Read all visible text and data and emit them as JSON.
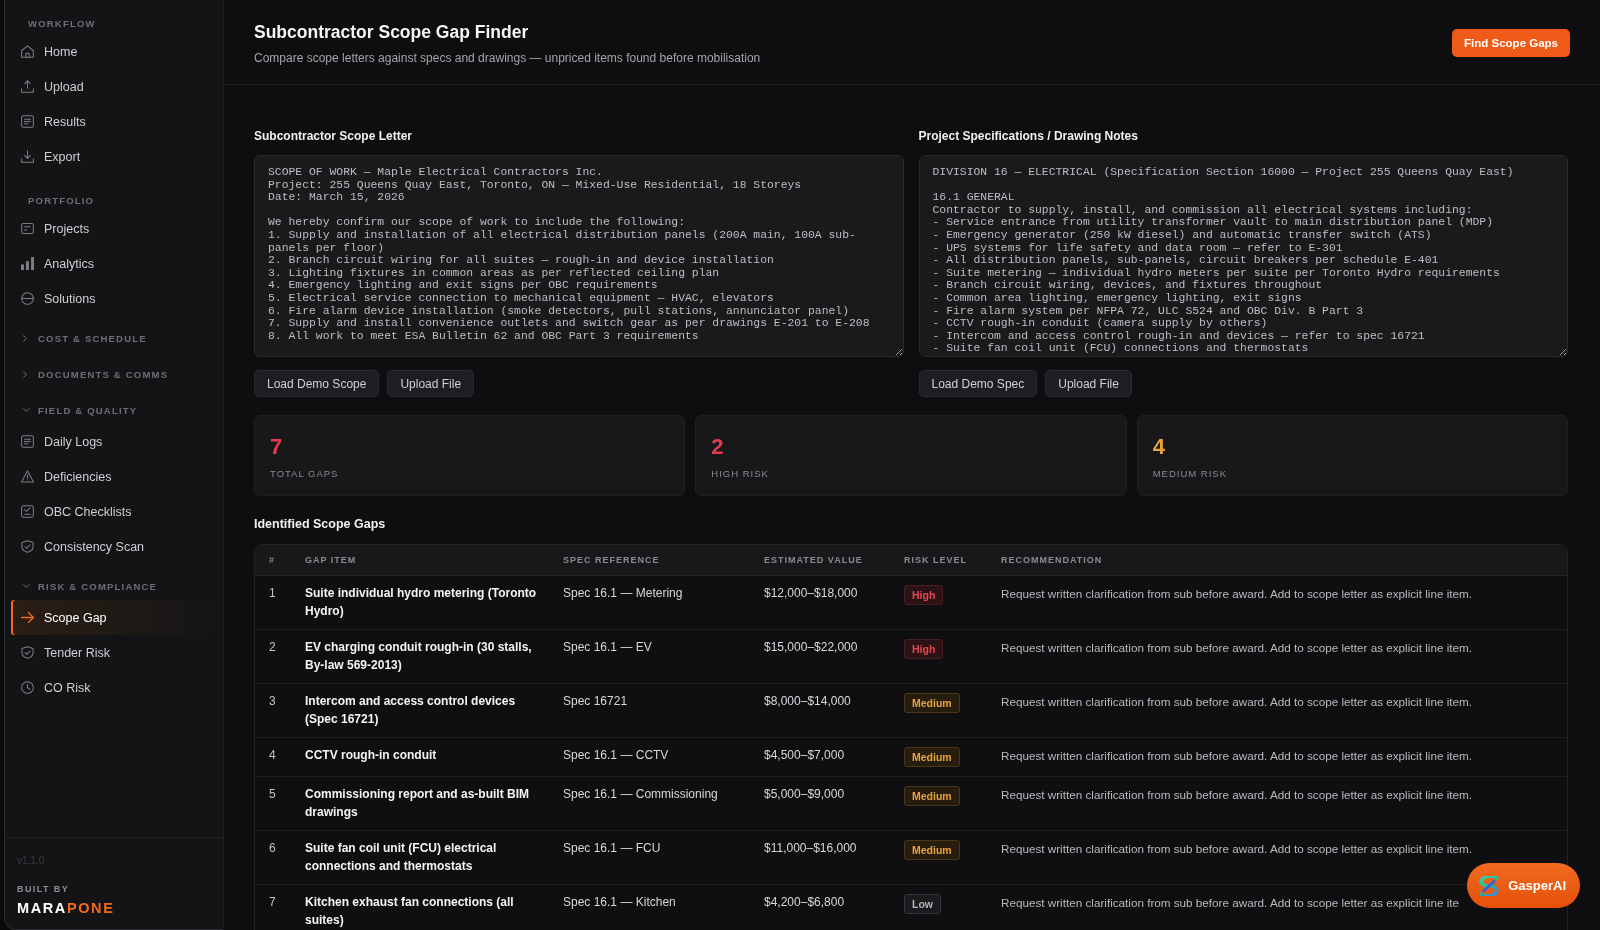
{
  "sidebar": {
    "sections": [
      {
        "kind": "label",
        "title": "WORKFLOW",
        "items": [
          {
            "label": "Home",
            "selected": false
          },
          {
            "label": "Upload",
            "selected": false
          },
          {
            "label": "Results",
            "selected": false
          },
          {
            "label": "Export",
            "selected": false
          }
        ]
      },
      {
        "kind": "label",
        "title": "PORTFOLIO",
        "items": [
          {
            "label": "Projects",
            "selected": false
          },
          {
            "label": "Analytics",
            "selected": false
          },
          {
            "label": "Solutions",
            "selected": false
          }
        ]
      },
      {
        "kind": "group",
        "title": "COST & SCHEDULE",
        "expanded": false
      },
      {
        "kind": "group",
        "title": "DOCUMENTS & COMMS",
        "expanded": false
      },
      {
        "kind": "group",
        "title": "FIELD & QUALITY",
        "expanded": true,
        "items": [
          {
            "label": "Daily Logs",
            "selected": false
          },
          {
            "label": "Deficiencies",
            "selected": false
          },
          {
            "label": "OBC Checklists",
            "selected": false
          },
          {
            "label": "Consistency Scan",
            "selected": false
          }
        ]
      },
      {
        "kind": "group",
        "title": "RISK & COMPLIANCE",
        "expanded": true,
        "items": [
          {
            "label": "Scope Gap",
            "selected": true
          },
          {
            "label": "Tender Risk",
            "selected": false
          },
          {
            "label": "CO Risk",
            "selected": false
          }
        ]
      }
    ],
    "version": "v1.1.0",
    "built_by": "BUILT BY",
    "brand": {
      "text": "MARA",
      "accent": "PONE"
    }
  },
  "header": {
    "title": "Subcontractor Scope Gap Finder",
    "subtitle": "Compare scope letters against specs and drawings — unpriced items found before mobilisation",
    "action_button": "Find Scope Gaps"
  },
  "inputs": [
    {
      "label": "Subcontractor Scope Letter",
      "value": "SCOPE OF WORK — Maple Electrical Contractors Inc.\nProject: 255 Queens Quay East, Toronto, ON — Mixed-Use Residential, 18 Storeys\nDate: March 15, 2026\n\nWe hereby confirm our scope of work to include the following:\n1. Supply and installation of all electrical distribution panels (200A main, 100A sub-panels per floor)\n2. Branch circuit wiring for all suites — rough-in and device installation\n3. Lighting fixtures in common areas as per reflected ceiling plan\n4. Emergency lighting and exit signs per OBC requirements\n5. Electrical service connection to mechanical equipment — HVAC, elevators\n6. Fire alarm device installation (smoke detectors, pull stations, annunciator panel)\n7. Supply and install convenience outlets and switch gear as per drawings E-201 to E-208\n8. All work to meet ESA Bulletin 62 and OBC Part 3 requirements",
      "buttons": [
        "Load Demo Scope",
        "Upload File"
      ]
    },
    {
      "label": "Project Specifications / Drawing Notes",
      "value": "DIVISION 16 — ELECTRICAL (Specification Section 16000 — Project 255 Queens Quay East)\n\n16.1 GENERAL\nContractor to supply, install, and commission all electrical systems including:\n- Service entrance from utility transformer vault to main distribution panel (MDP)\n- Emergency generator (250 kW diesel) and automatic transfer switch (ATS)\n- UPS systems for life safety and data room — refer to E-301\n- All distribution panels, sub-panels, circuit breakers per schedule E-401\n- Suite metering — individual hydro meters per suite per Toronto Hydro requirements\n- Branch circuit wiring, devices, and fixtures throughout\n- Common area lighting, emergency lighting, exit signs\n- Fire alarm system per NFPA 72, ULC S524 and OBC Div. B Part 3\n- CCTV rough-in conduit (camera supply by others)\n- Intercom and access control rough-in and devices — refer to spec 16721\n- Suite fan coil unit (FCU) connections and thermostats",
      "buttons": [
        "Load Demo Spec",
        "Upload File"
      ]
    }
  ],
  "stats": [
    {
      "value": "7",
      "label": "TOTAL GAPS",
      "color": "#e5394f"
    },
    {
      "value": "2",
      "label": "HIGH RISK",
      "color": "#e5394f"
    },
    {
      "value": "4",
      "label": "MEDIUM RISK",
      "color": "#e8a33d"
    }
  ],
  "gaps_table": {
    "title": "Identified Scope Gaps",
    "columns": [
      "#",
      "GAP ITEM",
      "SPEC REFERENCE",
      "ESTIMATED VALUE",
      "RISK LEVEL",
      "RECOMMENDATION"
    ],
    "rows": [
      {
        "number": "1",
        "gap_item": "Suite individual hydro metering (Toronto Hydro)",
        "spec_reference": "Spec 16.1 — Metering",
        "estimated_value": "$12,000–$18,000",
        "risk": {
          "text": "High",
          "kind": "high"
        },
        "recommendation": "Request written clarification from sub before award. Add to scope letter as explicit line item."
      },
      {
        "number": "2",
        "gap_item": "EV charging conduit rough-in (30 stalls, By-law 569-2013)",
        "spec_reference": "Spec 16.1 — EV",
        "estimated_value": "$15,000–$22,000",
        "risk": {
          "text": "High",
          "kind": "high"
        },
        "recommendation": "Request written clarification from sub before award. Add to scope letter as explicit line item."
      },
      {
        "number": "3",
        "gap_item": "Intercom and access control devices (Spec 16721)",
        "spec_reference": "Spec 16721",
        "estimated_value": "$8,000–$14,000",
        "risk": {
          "text": "Medium",
          "kind": "medium"
        },
        "recommendation": "Request written clarification from sub before award. Add to scope letter as explicit line item."
      },
      {
        "number": "4",
        "gap_item": "CCTV rough-in conduit",
        "spec_reference": "Spec 16.1 — CCTV",
        "estimated_value": "$4,500–$7,000",
        "risk": {
          "text": "Medium",
          "kind": "medium"
        },
        "recommendation": "Request written clarification from sub before award. Add to scope letter as explicit line item."
      },
      {
        "number": "5",
        "gap_item": "Commissioning report and as-built BIM drawings",
        "spec_reference": "Spec 16.1 — Commissioning",
        "estimated_value": "$5,000–$9,000",
        "risk": {
          "text": "Medium",
          "kind": "medium"
        },
        "recommendation": "Request written clarification from sub before award. Add to scope letter as explicit line item."
      },
      {
        "number": "6",
        "gap_item": "Suite fan coil unit (FCU) electrical connections and thermostats",
        "spec_reference": "Spec 16.1 — FCU",
        "estimated_value": "$11,000–$16,000",
        "risk": {
          "text": "Medium",
          "kind": "medium"
        },
        "recommendation": "Request written clarification from sub before award. Add to scope letter as explicit line item."
      },
      {
        "number": "7",
        "gap_item": "Kitchen exhaust fan connections (all suites)",
        "spec_reference": "Spec 16.1 — Kitchen",
        "estimated_value": "$4,200–$6,800",
        "risk": {
          "text": "Low",
          "kind": "low"
        },
        "recommendation": "Request written clarification from sub before award. Add to scope letter as explicit line ite"
      }
    ]
  },
  "assistant_button": {
    "label": "GasperAI"
  }
}
